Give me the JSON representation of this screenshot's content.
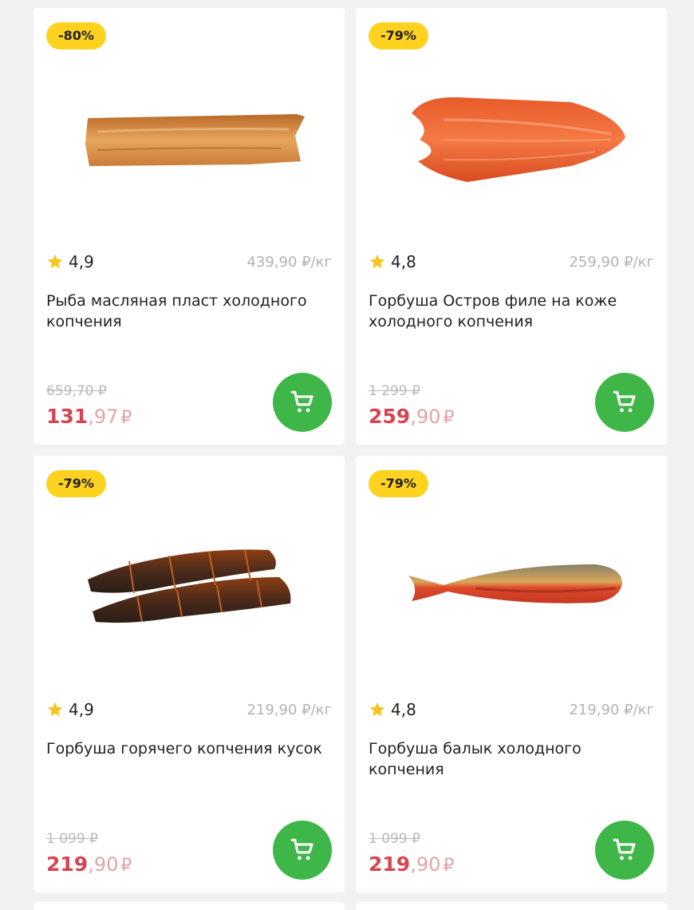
{
  "colors": {
    "badge": "#ffd21f",
    "price": "#d64451",
    "cart_button": "#3fb648",
    "star": "#f6c51b"
  },
  "products": [
    {
      "discount": "-80%",
      "rating": "4,9",
      "unit_price": "439,90 ₽/кг",
      "name": "Рыба масляная пласт холодного копчения",
      "old_price": "659,70 ₽",
      "price_int": "131",
      "price_frac": ",97",
      "currency": "₽",
      "image": "butterfish-fillet-image",
      "cart_icon": "cart-icon"
    },
    {
      "discount": "-79%",
      "rating": "4,8",
      "unit_price": "259,90 ₽/кг",
      "name": "Горбуша Остров филе на коже холодного копчения",
      "old_price": "1 299 ₽",
      "price_int": "259",
      "price_frac": ",90",
      "currency": "₽",
      "image": "salmon-fillet-image",
      "cart_icon": "cart-icon"
    },
    {
      "discount": "-79%",
      "rating": "4,9",
      "unit_price": "219,90 ₽/кг",
      "name": "Горбуша горячего копчения кусок",
      "old_price": "1 099 ₽",
      "price_int": "219",
      "price_frac": ",90",
      "currency": "₽",
      "image": "hot-smoked-salmon-image",
      "cart_icon": "cart-icon"
    },
    {
      "discount": "-79%",
      "rating": "4,8",
      "unit_price": "219,90 ₽/кг",
      "name": "Горбуша балык холодного копчения",
      "old_price": "1 099 ₽",
      "price_int": "219",
      "price_frac": ",90",
      "currency": "₽",
      "image": "salmon-balyk-image",
      "cart_icon": "cart-icon"
    }
  ]
}
